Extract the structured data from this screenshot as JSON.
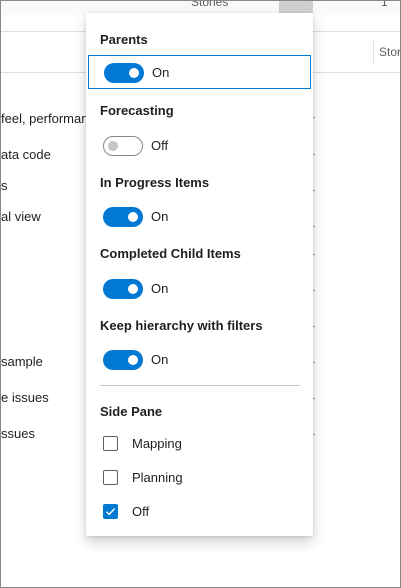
{
  "background": {
    "top_label": "Stories",
    "top_count": "1",
    "column_header": "Stor",
    "rows": [
      "feel, performan",
      "ata code",
      "s",
      "al view",
      "sample",
      "e issues",
      "ssues"
    ]
  },
  "menu": {
    "sections": [
      {
        "title": "Parents",
        "state": "On"
      },
      {
        "title": "Forecasting",
        "state": "Off"
      },
      {
        "title": "In Progress Items",
        "state": "On"
      },
      {
        "title": "Completed Child Items",
        "state": "On"
      },
      {
        "title": "Keep hierarchy with filters",
        "state": "On"
      }
    ],
    "side_pane": {
      "title": "Side Pane",
      "options": [
        {
          "label": "Mapping",
          "checked": false
        },
        {
          "label": "Planning",
          "checked": false
        },
        {
          "label": "Off",
          "checked": true
        }
      ]
    }
  },
  "colors": {
    "accent": "#0078d4",
    "toggle_off_border": "#8a8886",
    "divider": "#c8c6c4"
  }
}
